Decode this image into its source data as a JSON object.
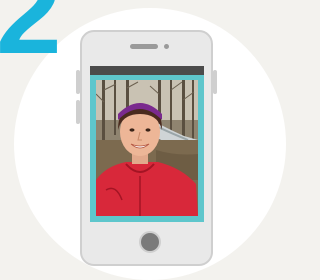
{
  "step": {
    "number": "2"
  },
  "colors": {
    "accent": "#1ab4dc",
    "screen_frame": "#5ec6cc",
    "phone_body": "#e9e9e9",
    "background": "#f3f2ee"
  },
  "phone": {
    "screen_content": "selfie-photo"
  }
}
